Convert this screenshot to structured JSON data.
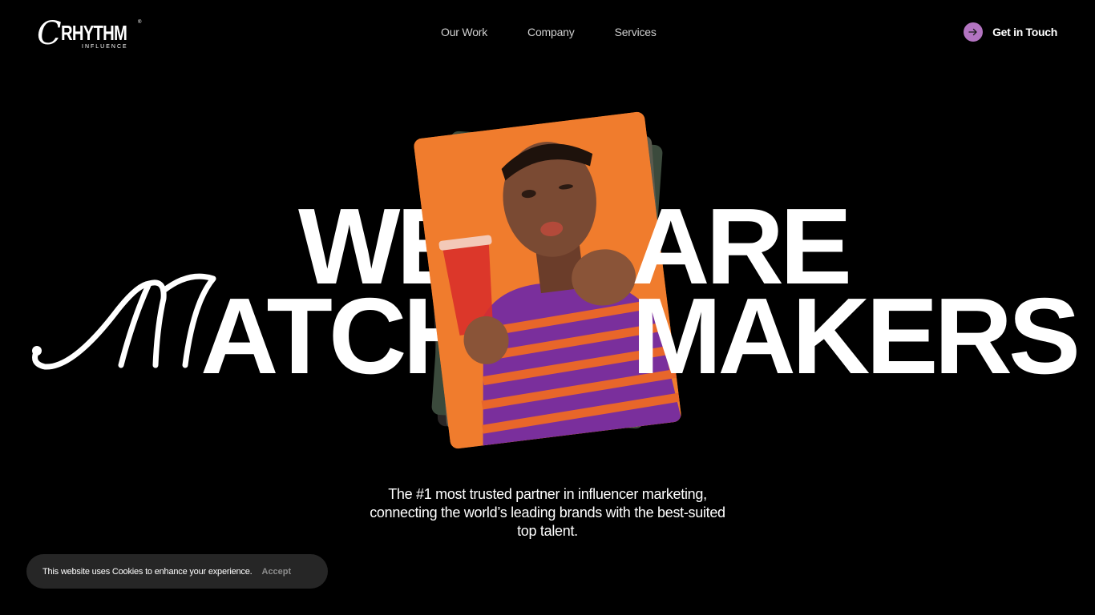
{
  "brand": {
    "logo_mark": "C",
    "logo_word": "RHYTHM",
    "logo_sub": "INFLUENCE",
    "registered": "®"
  },
  "nav": {
    "items": [
      {
        "label": "Our Work"
      },
      {
        "label": "Company"
      },
      {
        "label": "Services"
      }
    ]
  },
  "cta": {
    "label": "Get in Touch",
    "icon": "arrow-right-icon",
    "color": "#b374c1"
  },
  "hero": {
    "line1_left": "WE",
    "line1_right": "ARE",
    "line2_script": "M",
    "line2_left": "ATCH",
    "line2_right": "MAKERS"
  },
  "tagline": "The #1 most trusted partner in influencer marketing, connecting the world’s leading brands with the best-suited top talent.",
  "cookie": {
    "message": "This website uses Cookies to enhance your experience.",
    "accept_label": "Accept"
  },
  "colors": {
    "background": "#000000",
    "accent": "#b374c1",
    "photo_bg": "#f07c2d"
  }
}
